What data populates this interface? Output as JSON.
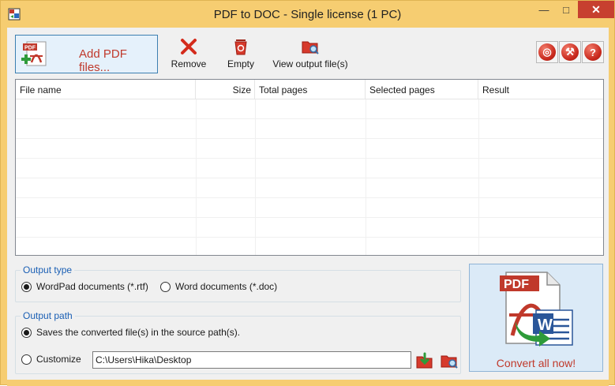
{
  "window": {
    "title": "PDF to DOC - Single license (1 PC)",
    "minimize": "—",
    "maximize": "□",
    "close": "✕"
  },
  "toolbar": {
    "add_pdf_label": "Add PDF files...",
    "add_pdf_icon": "pdf-add-icon",
    "remove_label": "Remove",
    "remove_icon": "red-x-icon",
    "empty_label": "Empty",
    "empty_icon": "recycle-bin-icon",
    "view_output_label": "View output file(s)",
    "view_output_icon": "folder-search-icon",
    "right_buttons": [
      {
        "name": "web-icon",
        "glyph": "◎"
      },
      {
        "name": "settings-icon",
        "glyph": "⚒"
      },
      {
        "name": "help-icon",
        "glyph": "?"
      }
    ]
  },
  "file_table": {
    "columns": [
      "File name",
      "Size",
      "Total pages",
      "Selected pages",
      "Result"
    ],
    "rows": []
  },
  "output_type": {
    "title": "Output type",
    "options": [
      {
        "label": "WordPad documents (*.rtf)",
        "selected": true
      },
      {
        "label": "Word documents (*.doc)",
        "selected": false
      }
    ]
  },
  "output_path": {
    "title": "Output path",
    "source_path_label": "Saves the converted file(s) in the source path(s).",
    "source_path_selected": true,
    "customize_label": "Customize",
    "customize_selected": false,
    "path_value": "C:\\Users\\Hika\\Desktop"
  },
  "convert": {
    "label": "Convert all now!",
    "badge": "PDF",
    "word_letter": "W"
  },
  "colors": {
    "title_bar": "#f6cd71",
    "accent_red": "#c0392b",
    "group_title": "#1a5fb4",
    "convert_bg": "#dbeaf7"
  }
}
